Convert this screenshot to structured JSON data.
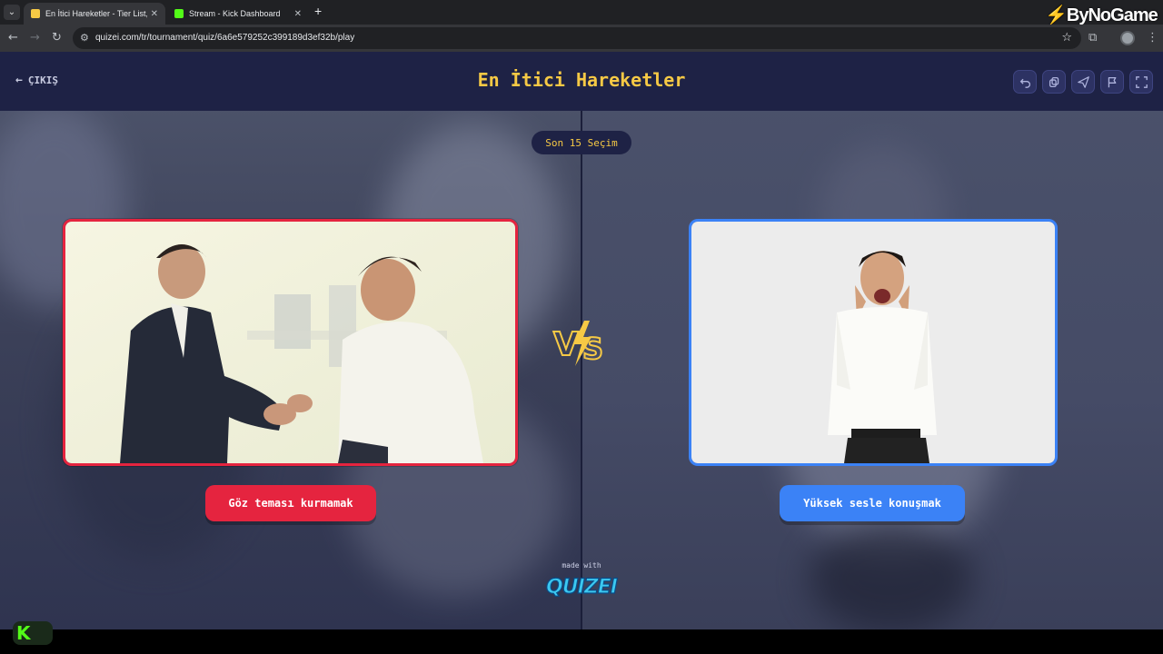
{
  "browser": {
    "tabs": [
      {
        "title": "En İtici Hareketler - Tier List, Kö",
        "active": true,
        "favicon": "quizei-favicon",
        "color": "#f6c945"
      },
      {
        "title": "Stream - Kick Dashboard",
        "active": false,
        "favicon": "kick-favicon",
        "color": "#53fc18"
      }
    ],
    "new_tab_label": "+",
    "url": "quizei.com/tr/tournament/quiz/6a6e579252c399189d3ef32b/play",
    "overlay_brand": "ByNoGame"
  },
  "header": {
    "back_label": "ÇIKIŞ",
    "title": "En İtici Hareketler",
    "tools": [
      "undo-icon",
      "copy-icon",
      "send-icon",
      "flag-icon",
      "fullscreen-icon"
    ]
  },
  "round": {
    "label": "Son 15 Seçim"
  },
  "options": {
    "left": {
      "label": "Göz teması kurmamak",
      "color": "#e5243f"
    },
    "right": {
      "label": "Yüksek sesle konuşmak",
      "color": "#3b82f6"
    }
  },
  "footer": {
    "made_with": "made with",
    "brand": "QUIZEI"
  },
  "colors": {
    "accent_yellow": "#f6c945",
    "header_bg": "#1e2245",
    "kick_green": "#53fc18"
  }
}
